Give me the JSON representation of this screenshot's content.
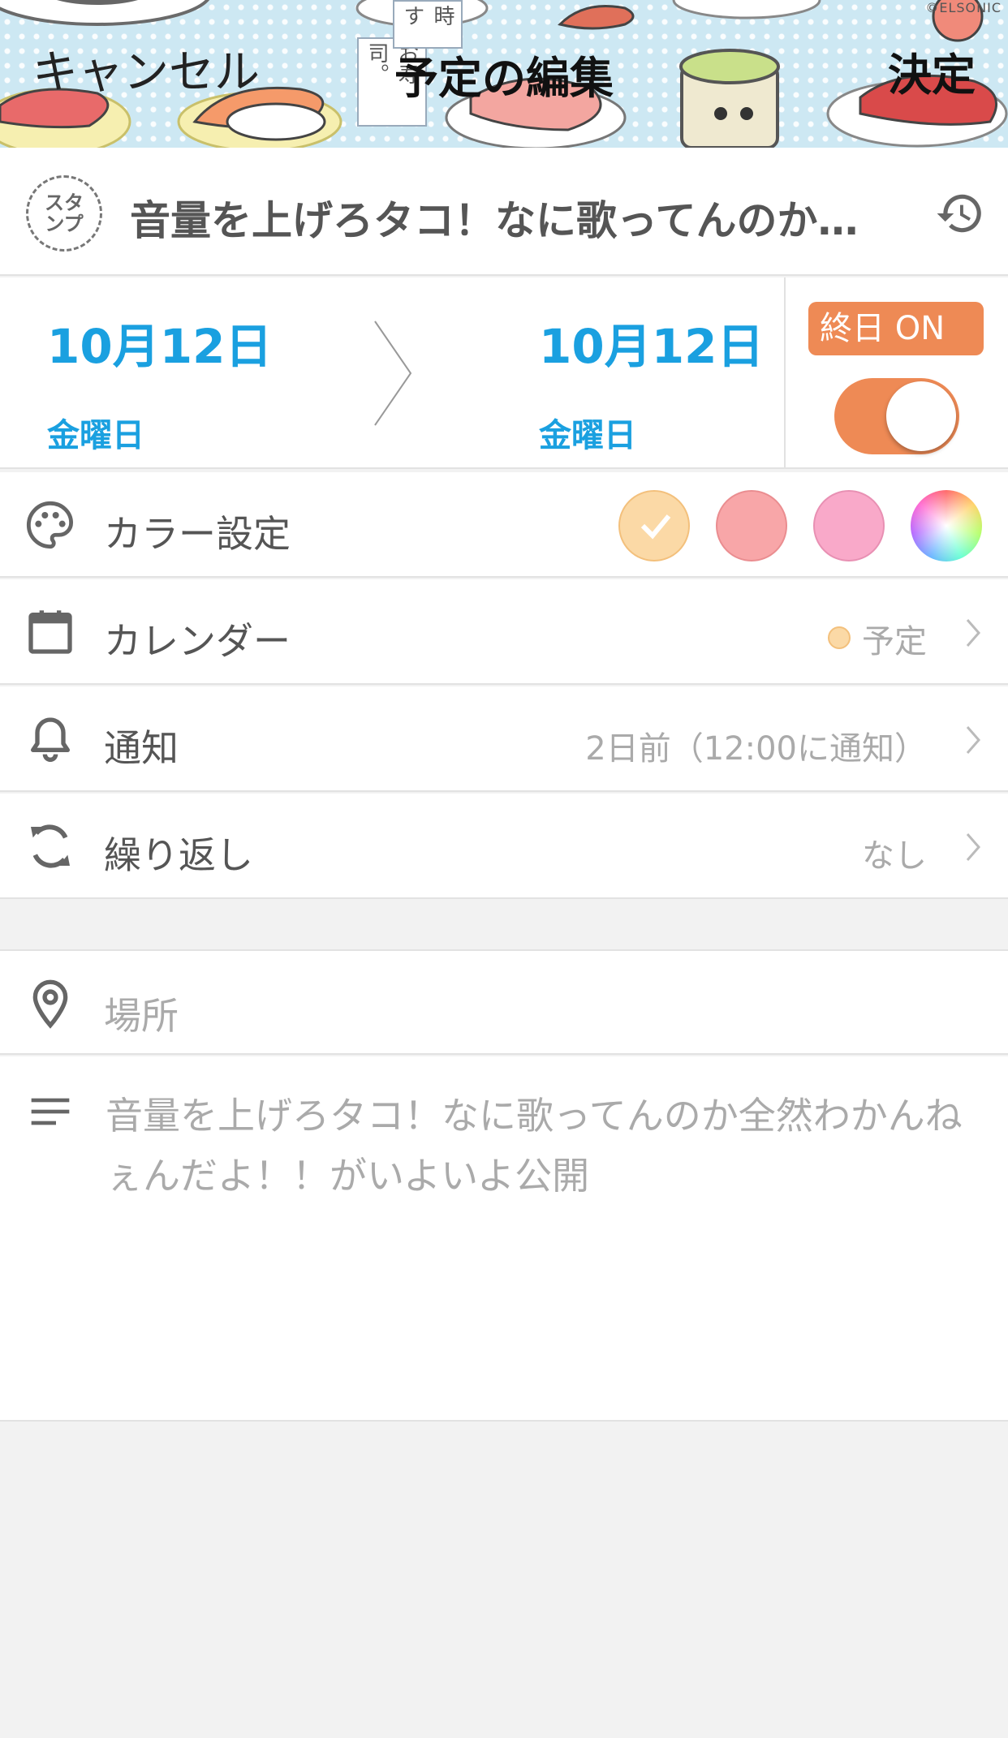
{
  "header": {
    "cancel_label": "キャンセル",
    "title": "予定の編集",
    "done_label": "決定",
    "copyright": "©ELSONIC",
    "tag_top": "時す",
    "tag_bottom": "お寿司。"
  },
  "event": {
    "stamp_label_line1": "スタ",
    "stamp_label_line2": "ンプ",
    "title": "音量を上げろタコ！なに歌ってんのか…",
    "history_icon": "history-icon"
  },
  "dates": {
    "start_date": "10月12日",
    "start_dow": "金曜日",
    "end_date": "10月12日",
    "end_dow": "金曜日",
    "allday_label": "終日 ON",
    "allday_on": true,
    "date_color": "#1aa0e0",
    "accent_color": "#ee8a55"
  },
  "settings": {
    "color": {
      "label": "カラー設定",
      "icon": "palette-icon",
      "swatches": [
        {
          "name": "light-orange",
          "color": "#fbd9a6",
          "selected": true
        },
        {
          "name": "salmon",
          "color": "#f8a6a8",
          "selected": false
        },
        {
          "name": "pink",
          "color": "#f9a9c9",
          "selected": false
        },
        {
          "name": "custom-rainbow",
          "color": "rainbow",
          "selected": false
        }
      ]
    },
    "calendar": {
      "label": "カレンダー",
      "value": "予定",
      "icon": "calendar-icon"
    },
    "notification": {
      "label": "通知",
      "value": "2日前（12:00に通知）",
      "icon": "bell-icon"
    },
    "repeat": {
      "label": "繰り返し",
      "value": "なし",
      "icon": "repeat-icon"
    }
  },
  "location": {
    "placeholder": "場所",
    "icon": "location-pin-icon"
  },
  "memo": {
    "icon": "memo-lines-icon",
    "text": "音量を上げろタコ！なに歌ってんのか全然わかんねぇんだよ！！がいよいよ公開"
  }
}
